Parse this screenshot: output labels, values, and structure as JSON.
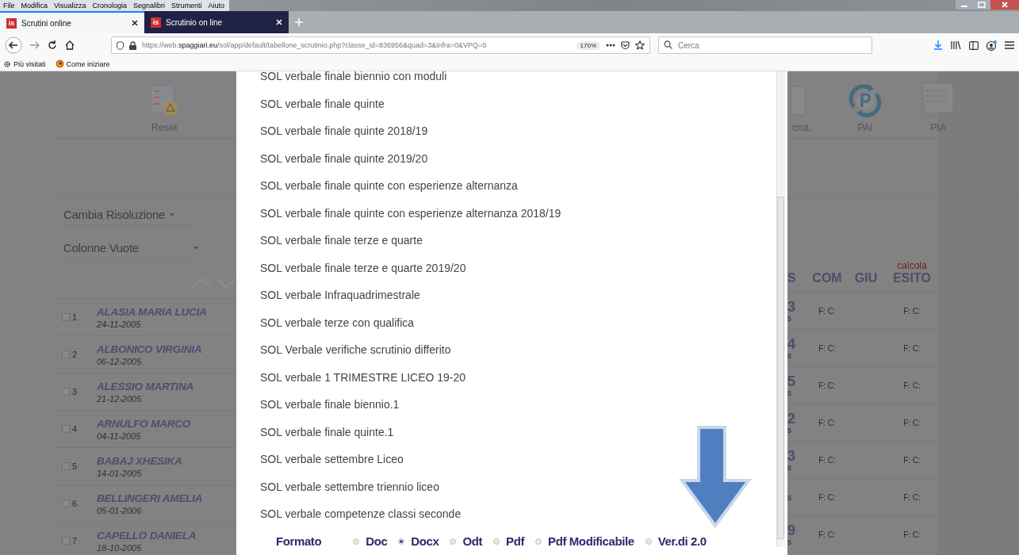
{
  "browser": {
    "menu": [
      "File",
      "Modifica",
      "Visualizza",
      "Cronologia",
      "Segnalibri",
      "Strumenti",
      "Aiuto"
    ],
    "tabs": [
      {
        "icon_text": "is",
        "title": "Scrutini online",
        "selected": true
      },
      {
        "icon_text": "is",
        "title": "Scrutinio on line",
        "selected": false
      }
    ],
    "url_parts": [
      {
        "text": "https://web.",
        "kind": "dim"
      },
      {
        "text": "spaggiari.eu",
        "kind": "host"
      },
      {
        "text": "/sol/app/default/tabellone_scrutinio.php?classe_id=836956&quad=3&infra=0&VPQ=0",
        "kind": "dim"
      }
    ],
    "zoom": "170%",
    "search": {
      "placeholder": "Cerca"
    },
    "bookmarks": [
      "Più visitati",
      "Come iniziare"
    ]
  },
  "page": {
    "toolbar": [
      {
        "label": "Reset",
        "kind": "reset"
      },
      {
        "label": "crut.",
        "kind": "doc"
      },
      {
        "label": "PAI",
        "kind": "pai"
      },
      {
        "label": "PIA",
        "kind": "pia"
      }
    ],
    "dropdowns": [
      "Cambia Risoluzione",
      "Colonne Vuote"
    ],
    "columns": [
      {
        "label": "S"
      },
      {
        "label": "COM"
      },
      {
        "label": "GIU"
      },
      {
        "label": "ESITO",
        "action": "calcola"
      }
    ],
    "students": [
      {
        "number": "1",
        "name": "ALASIA MARIA LUCIA",
        "birth_date": "24-11-2005",
        "checked": false,
        "column_1": "3",
        "column_1_note": "s",
        "com": "F: C:",
        "esito": "F: C:"
      },
      {
        "number": "2",
        "name": "ALBONICO VIRGINIA",
        "birth_date": "06-12-2005",
        "checked": false,
        "column_1": "4",
        "column_1_note": "s",
        "com": "F: C:",
        "esito": "F: C:"
      },
      {
        "number": "3",
        "name": "ALESSIO MARTINA",
        "birth_date": "21-12-2005",
        "checked": false,
        "column_1": "5",
        "column_1_note": "s",
        "com": "F: C:",
        "esito": "F: C:"
      },
      {
        "number": "4",
        "name": "ARNULFO MARCO",
        "birth_date": "04-11-2005",
        "checked": false,
        "column_1": "2",
        "column_1_note": "s",
        "com": "F: C:",
        "esito": "F: C:"
      },
      {
        "number": "5",
        "name": "BABAJ XHESIKA",
        "birth_date": "14-01-2005",
        "checked": false,
        "column_1": "3",
        "column_1_note": "s",
        "com": "F: C:",
        "esito": "F: C:"
      },
      {
        "number": "6",
        "name": "BELLINGERI AMELIA",
        "birth_date": "05-01-2006",
        "checked": false,
        "column_1_note": "s",
        "com": "F: C:",
        "esito": "F: C:"
      },
      {
        "number": "7",
        "name": "CAPELLO DANIELA",
        "birth_date": "18-10-2005",
        "checked": false,
        "column_1": "9",
        "column_1_note": "s",
        "com": "F: C:",
        "esito": "F: C:"
      }
    ]
  },
  "modal": {
    "items": [
      "SOL verbale finale biennio con moduli",
      "SOL verbale finale quinte",
      "SOL verbale finale quinte 2018/19",
      "SOL verbale finale quinte 2019/20",
      "SOL verbale finale quinte con esperienze alternanza",
      "SOL verbale finale quinte con esperienze alternanza 2018/19",
      "SOL verbale finale terze e quarte",
      "SOL verbale finale terze e quarte 2019/20",
      "SOL verbale Infraquadrimestrale",
      "SOL verbale terze con qualifica",
      "SOL Verbale verifiche scrutinio differito",
      "SOL verbale 1 TRIMESTRE LICEO 19-20",
      "SOL verbale finale biennio.1",
      "SOL verbale finale quinte.1",
      "SOL verbale settembre Liceo",
      "SOL verbale settembre triennio liceo",
      "SOL verbale competenze classi seconde"
    ],
    "format": {
      "label": "Formato",
      "options": [
        {
          "label": "Doc",
          "selected": false
        },
        {
          "label": "Docx",
          "selected": true
        },
        {
          "label": "Odt",
          "selected": false
        },
        {
          "label": "Pdf",
          "selected": false
        },
        {
          "label": "Pdf Modificabile",
          "selected": false
        },
        {
          "label": "Ver.di 2.0",
          "selected": false
        }
      ]
    }
  }
}
